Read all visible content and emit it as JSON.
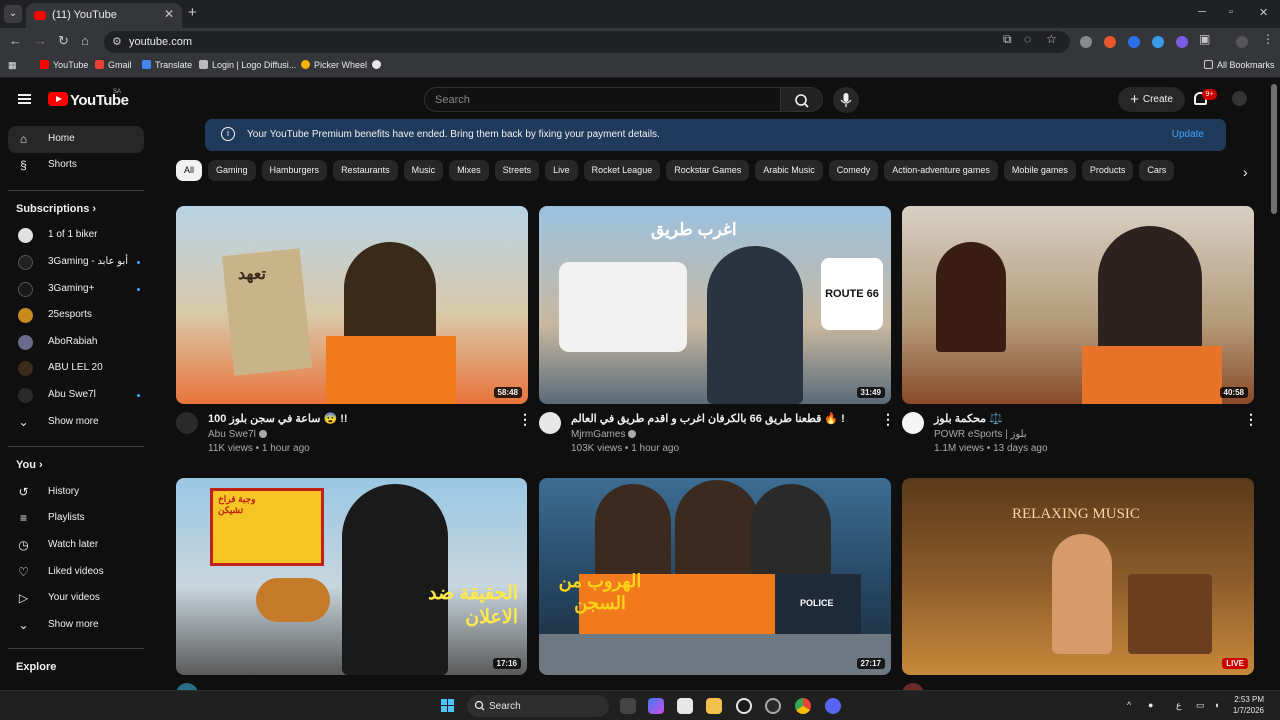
{
  "browser": {
    "tab_title": "(11) YouTube",
    "url": "youtube.com",
    "bookmarks": [
      "YouTube",
      "Gmail",
      "Translate",
      "Login | Logo Diffusi...",
      "Picker Wheel"
    ],
    "all_bookmarks": "All Bookmarks"
  },
  "header": {
    "logo_text": "YouTube",
    "country_code": "SA",
    "search_placeholder": "Search",
    "create_label": "Create",
    "notification_count": "9+"
  },
  "sidebar": {
    "main": [
      {
        "label": "Home",
        "icon": "home-icon",
        "active": true
      },
      {
        "label": "Shorts",
        "icon": "shorts-icon",
        "active": false
      }
    ],
    "subscriptions_heading": "Subscriptions",
    "subscriptions": [
      {
        "label": "1 of 1 biker",
        "new": false
      },
      {
        "label": "3Gaming - أبو عابد",
        "new": true
      },
      {
        "label": "3Gaming+",
        "new": true
      },
      {
        "label": "25esports",
        "new": false
      },
      {
        "label": "AboRabiah",
        "new": false
      },
      {
        "label": "ABU LEL 20",
        "new": false
      },
      {
        "label": "Abu Swe7l",
        "new": true
      }
    ],
    "subs_show_more": "Show more",
    "you_heading": "You",
    "you_items": [
      {
        "label": "History",
        "icon": "history-icon"
      },
      {
        "label": "Playlists",
        "icon": "playlists-icon"
      },
      {
        "label": "Watch later",
        "icon": "watch-later-icon"
      },
      {
        "label": "Liked videos",
        "icon": "like-icon"
      },
      {
        "label": "Your videos",
        "icon": "your-videos-icon"
      }
    ],
    "you_show_more": "Show more",
    "explore_heading": "Explore"
  },
  "banner": {
    "message": "Your YouTube Premium benefits have ended. Bring them back by fixing your payment details.",
    "action": "Update"
  },
  "chips": [
    "All",
    "Gaming",
    "Hamburgers",
    "Restaurants",
    "Music",
    "Mixes",
    "Streets",
    "Live",
    "Rocket League",
    "Rockstar Games",
    "Arabic Music",
    "Comedy",
    "Action-adventure games",
    "Mobile games",
    "Products",
    "Cars"
  ],
  "videos": [
    {
      "title": "100 ساعة في سجن بلوز 😨 !!",
      "channel": "Abu Swe7l",
      "meta": "11K views • 1 hour ago",
      "duration": "58:48",
      "thumb_colors": [
        "#b7d3e6",
        "#e8743b"
      ]
    },
    {
      "title": "قطعنا طريق 66 بالكرفان اغرب و اقدم طريق في العالم 🔥 !",
      "channel": "MjrmGames",
      "meta": "103K views • 1 hour ago",
      "duration": "31:49",
      "thumb_colors": [
        "#9cc1e0",
        "#5b6b7a"
      ]
    },
    {
      "title": "محكمة بلوز ⚖️",
      "channel": "POWR eSports | بلوز",
      "meta": "1.1M views • 13 days ago",
      "duration": "40:58",
      "thumb_colors": [
        "#d8cfc3",
        "#e8742a"
      ]
    },
    {
      "title": "",
      "channel": "",
      "meta": "",
      "duration": "17:16",
      "thumb_colors": [
        "#9ac7e3",
        "#1a1a1a"
      ]
    },
    {
      "title": "",
      "channel": "",
      "meta": "",
      "duration": "27:17",
      "thumb_colors": [
        "#3d6d93",
        "#f07a1c"
      ]
    },
    {
      "title": "",
      "channel": "",
      "meta": "",
      "duration": "LIVE",
      "thumb_colors": [
        "#5a3a1a",
        "#c7893a"
      ]
    }
  ],
  "thumb_text": [
    "تعهد",
    "اغرب طريق",
    "ROUTE 66",
    "وجبة فراخ تشيكن",
    "الحقيقة ضد الاعلان",
    "الهروب من السجن",
    "POLICE",
    "RELAXING MUSIC"
  ],
  "taskbar": {
    "search_placeholder": "Search",
    "time": "2:53 PM",
    "date": "1/7/2026",
    "lang": "ع"
  },
  "colors": {
    "accent_red": "#ff0000",
    "link_blue": "#3ea6ff",
    "banner_bg": "#1f3a5a"
  }
}
